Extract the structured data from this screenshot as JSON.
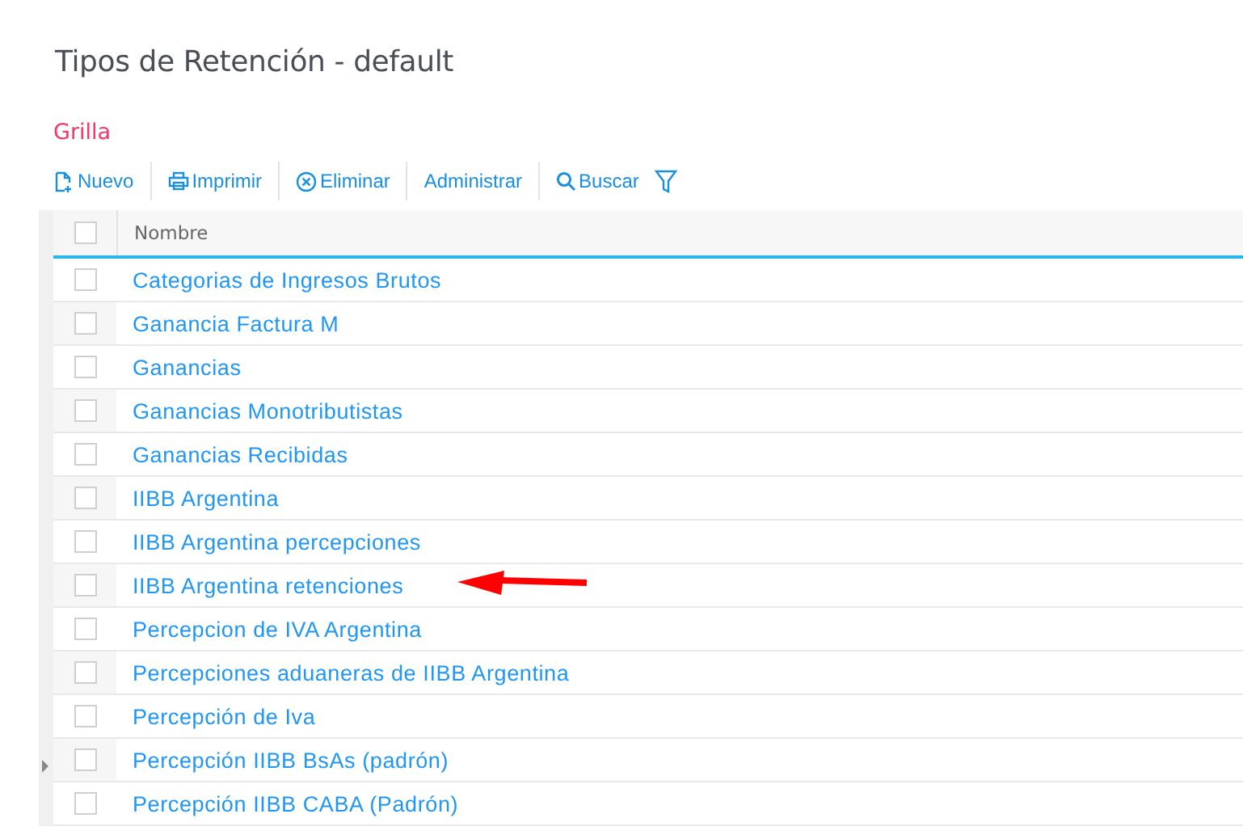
{
  "page": {
    "title": "Tipos de Retención - default"
  },
  "section": {
    "label": "Grilla"
  },
  "toolbar": [
    {
      "kind": "new",
      "label": "Nuevo"
    },
    {
      "kind": "print",
      "label": "Imprimir"
    },
    {
      "kind": "delete",
      "label": "Eliminar"
    },
    {
      "kind": "plain",
      "label": "Administrar"
    },
    {
      "kind": "search",
      "label": "Buscar"
    },
    {
      "kind": "filter"
    }
  ],
  "table": {
    "columns": [
      "Nombre"
    ],
    "header_checked": false,
    "rows": [
      {
        "name": "Categorias de Ingresos Brutos",
        "checked": false,
        "marked": false
      },
      {
        "name": "Ganancia Factura M",
        "checked": false,
        "marked": false
      },
      {
        "name": "Ganancias",
        "checked": false,
        "marked": false
      },
      {
        "name": "Ganancias Monotributistas",
        "checked": false,
        "marked": false
      },
      {
        "name": "Ganancias Recibidas",
        "checked": false,
        "marked": false
      },
      {
        "name": "IIBB Argentina",
        "checked": false,
        "marked": false
      },
      {
        "name": "IIBB Argentina percepciones",
        "checked": false,
        "marked": false
      },
      {
        "name": "IIBB Argentina retenciones",
        "checked": false,
        "marked": true
      },
      {
        "name": "Percepcion de IVA Argentina",
        "checked": false,
        "marked": false
      },
      {
        "name": "Percepciones aduaneras de IIBB Argentina",
        "checked": false,
        "marked": false
      },
      {
        "name": "Percepción de Iva",
        "checked": false,
        "marked": false
      },
      {
        "name": "Percepción IIBB BsAs (padrón)",
        "checked": false,
        "marked": false
      },
      {
        "name": "Percepción IIBB CABA (Padrón)",
        "checked": false,
        "marked": false
      }
    ]
  }
}
